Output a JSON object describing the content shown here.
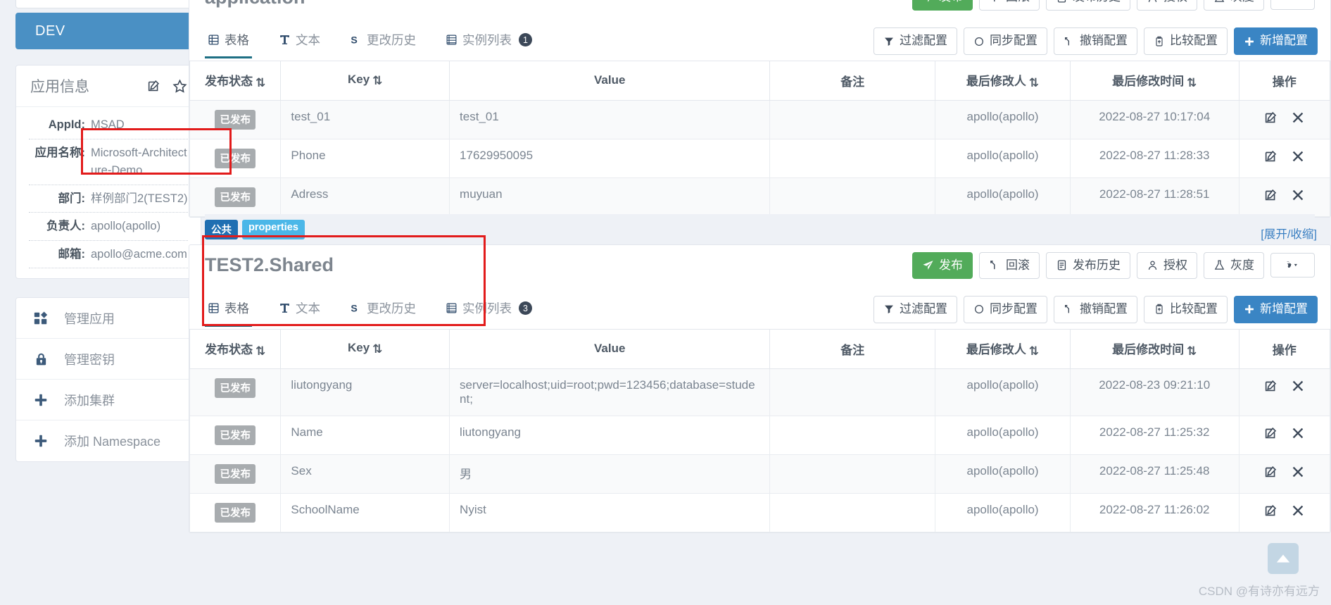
{
  "sidebar": {
    "env_button": "DEV",
    "app_info": {
      "title": "应用信息",
      "rows": [
        {
          "label": "AppId:",
          "value": "MSAD"
        },
        {
          "label": "应用名称:",
          "value": "Microsoft-Architecture-Demo"
        },
        {
          "label": "部门:",
          "value": "样例部门2(TEST2)"
        },
        {
          "label": "负责人:",
          "value": "apollo(apollo)"
        },
        {
          "label": "邮箱:",
          "value": "apollo@acme.com"
        }
      ]
    },
    "menu": [
      {
        "label": "管理应用",
        "icon": "grid-icon"
      },
      {
        "label": "管理密钥",
        "icon": "lock-icon"
      },
      {
        "label": "添加集群",
        "icon": "plus-icon"
      },
      {
        "label": "添加 Namespace",
        "icon": "plus-icon"
      }
    ]
  },
  "table_headers": {
    "status": "发布状态",
    "key": "Key",
    "value": "Value",
    "remark": "备注",
    "user": "最后修改人",
    "time": "最后修改时间",
    "ops": "操作"
  },
  "tabs": [
    {
      "label": "表格",
      "icon": "table-icon"
    },
    {
      "label": "文本",
      "icon": "text-icon"
    },
    {
      "label": "更改历史",
      "icon": "history-icon"
    },
    {
      "label": "实例列表",
      "icon": "instances-icon"
    }
  ],
  "action_buttons": [
    {
      "label": "发布",
      "icon": "send-icon",
      "style": "green"
    },
    {
      "label": "回滚",
      "icon": "rollback-icon",
      "style": "default"
    },
    {
      "label": "发布历史",
      "icon": "list-icon",
      "style": "default"
    },
    {
      "label": "授权",
      "icon": "user-icon",
      "style": "default"
    },
    {
      "label": "灰度",
      "icon": "flask-icon",
      "style": "default"
    },
    {
      "label": "",
      "icon": "gear-caret-icon",
      "style": "default"
    }
  ],
  "tool_buttons": [
    {
      "label": "过滤配置",
      "icon": "filter-icon",
      "style": "default"
    },
    {
      "label": "同步配置",
      "icon": "sync-icon",
      "style": "default"
    },
    {
      "label": "撤销配置",
      "icon": "undo-icon",
      "style": "default"
    },
    {
      "label": "比较配置",
      "icon": "compare-icon",
      "style": "default"
    },
    {
      "label": "新增配置",
      "icon": "plus-icon",
      "style": "blue"
    }
  ],
  "expand_link": "[展开/收缩]",
  "panels": [
    {
      "name": "application",
      "title": "application",
      "tags": [],
      "instance_count": "1",
      "rows": [
        {
          "status": "已发布",
          "key": "test_01",
          "value": "test_01",
          "remark": "",
          "user": "apollo(apollo)",
          "time": "2022-08-27 10:17:04"
        },
        {
          "status": "已发布",
          "key": "Phone",
          "value": "17629950095",
          "remark": "",
          "user": "apollo(apollo)",
          "time": "2022-08-27 11:28:33"
        },
        {
          "status": "已发布",
          "key": "Adress",
          "value": "muyuan",
          "remark": "",
          "user": "apollo(apollo)",
          "time": "2022-08-27 11:28:51"
        }
      ]
    },
    {
      "name": "test2-shared",
      "title": "TEST2.Shared",
      "tags": [
        {
          "text": "公共",
          "kind": "public"
        },
        {
          "text": "properties",
          "kind": "type"
        }
      ],
      "instance_count": "3",
      "rows": [
        {
          "status": "已发布",
          "key": "liutongyang",
          "value": "server=localhost;uid=root;pwd=123456;database=student;",
          "remark": "",
          "user": "apollo(apollo)",
          "time": "2022-08-23 09:21:10"
        },
        {
          "status": "已发布",
          "key": "Name",
          "value": "liutongyang",
          "remark": "",
          "user": "apollo(apollo)",
          "time": "2022-08-27 11:25:32"
        },
        {
          "status": "已发布",
          "key": "Sex",
          "value": "男",
          "remark": "",
          "user": "apollo(apollo)",
          "time": "2022-08-27 11:25:48"
        },
        {
          "status": "已发布",
          "key": "SchoolName",
          "value": "Nyist",
          "remark": "",
          "user": "apollo(apollo)",
          "time": "2022-08-27 11:26:02"
        }
      ]
    }
  ],
  "watermark": "CSDN @有诗亦有远方",
  "colors": {
    "env_blue": "#4a90c4",
    "publish_green": "#52ab5a",
    "add_blue": "#3a85c4",
    "tag_public": "#1f6fb2",
    "tag_type": "#4bb7e8",
    "annotation_red": "#e21b1b",
    "active_tab_underline": "#1e6f84"
  }
}
